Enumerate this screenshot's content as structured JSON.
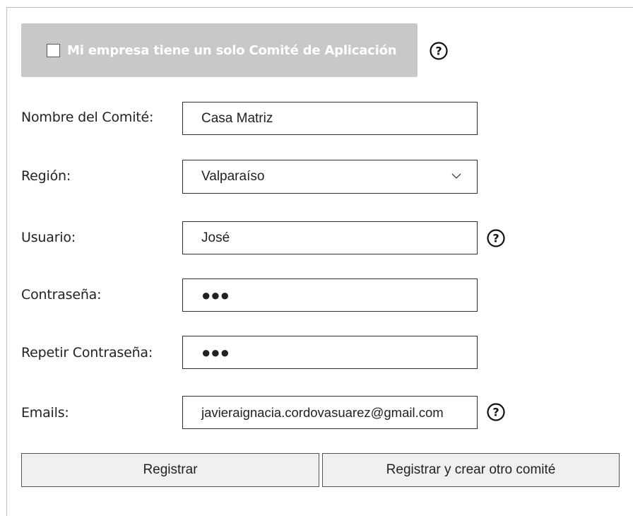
{
  "single_committee": {
    "label": "Mi empresa tiene un solo Comité de Aplicación",
    "checked": false
  },
  "form": {
    "committee_name": {
      "label": "Nombre del Comité:",
      "value": "Casa Matriz"
    },
    "region": {
      "label": "Región:",
      "value": "Valparaíso"
    },
    "user": {
      "label": "Usuario:",
      "value": "José"
    },
    "password": {
      "label": "Contraseña:",
      "value": "●●●"
    },
    "repeat_password": {
      "label": "Repetir Contraseña:",
      "value": "●●●"
    },
    "emails": {
      "label": "Emails:",
      "value": "javieraignacia.cordovasuarez@gmail.com"
    }
  },
  "buttons": {
    "register": "Registrar",
    "register_and_new": "Registrar y crear otro comité"
  },
  "icons": {
    "help": "help-circle-icon",
    "chevron": "chevron-down-icon",
    "checkbox": "checkbox-icon"
  }
}
